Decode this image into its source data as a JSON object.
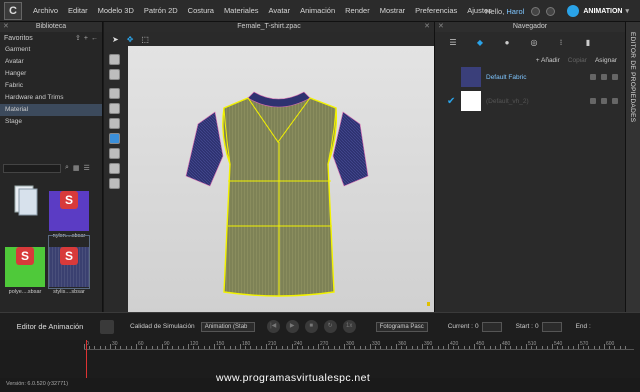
{
  "menu": {
    "logo": "C",
    "items": [
      "Archivo",
      "Editar",
      "Modelo 3D",
      "Patrón 2D",
      "Costura",
      "Materiales",
      "Avatar",
      "Animación",
      "Render",
      "Mostrar",
      "Preferencias",
      "Ajustes"
    ],
    "greeting": "Hello,",
    "user": "Harol",
    "mode_label": "ANIMATION"
  },
  "library": {
    "title": "Biblioteca",
    "favorites_label": "Favoritos",
    "items": [
      "Garment",
      "Avatar",
      "Hanger",
      "Fabric",
      "Hardware and Trims",
      "Material",
      "Stage"
    ],
    "selected_index": 5,
    "thumbnails": [
      {
        "caption": "",
        "color": "#ffffff"
      },
      {
        "caption": "nylon....sbsar",
        "color": "#5b3cc4"
      },
      {
        "caption": "polye....sbsar",
        "color": "#4fc93a"
      },
      {
        "caption": "stylis....sbsar",
        "color": "#3a4070"
      }
    ]
  },
  "viewport": {
    "title": "Female_T-shirt.zpac",
    "garment_color": "#8a8d5e",
    "seam_color": "#f2f200",
    "sleeve_color": "#2e3270"
  },
  "navigator": {
    "title": "Navegador",
    "actions": {
      "add": "+ Añadir",
      "copy": "Copiar",
      "assign": "Asignar"
    },
    "fabrics": [
      {
        "name": "Default Fabric",
        "color": "#3a3f7a",
        "active": true
      },
      {
        "name": "(Default_vh_2)",
        "color": "#ffffff",
        "active": false
      }
    ],
    "properties_label": "EDITOR DE PROPIEDADES"
  },
  "animation": {
    "editor_label": "Editor de Animación",
    "sim_quality_label": "Calidad de Simulación",
    "sim_quality_value": "Animation (Stab",
    "frame_mode": "Fotograma Pasc",
    "current_label": "Current :",
    "current_value": "0",
    "start_label": "Start :",
    "start_value": "0",
    "end_label": "End :",
    "ruler": [
      "0",
      "30",
      "60",
      "90",
      "120",
      "150",
      "180",
      "210",
      "240",
      "270",
      "300",
      "330",
      "360",
      "390",
      "420",
      "450",
      "480",
      "510",
      "540",
      "570",
      "600"
    ]
  },
  "status": {
    "version": "Versión: 6.0.520 (r32771)",
    "watermark": "www.programasvirtualespc.net"
  }
}
